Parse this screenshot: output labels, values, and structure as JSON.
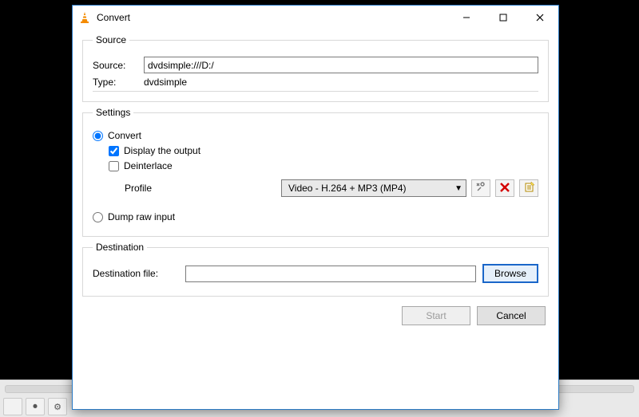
{
  "window": {
    "title": "Convert"
  },
  "source_group": {
    "legend": "Source",
    "source_label": "Source:",
    "source_value": "dvdsimple:///D:/",
    "type_label": "Type:",
    "type_value": "dvdsimple"
  },
  "settings_group": {
    "legend": "Settings",
    "convert_radio": "Convert",
    "display_output": "Display the output",
    "deinterlace": "Deinterlace",
    "profile_label": "Profile",
    "profile_value": "Video - H.264 + MP3 (MP4)",
    "dump_raw": "Dump raw input"
  },
  "destination_group": {
    "legend": "Destination",
    "dest_label": "Destination file:",
    "dest_value": "",
    "browse": "Browse"
  },
  "footer": {
    "start": "Start",
    "cancel": "Cancel"
  },
  "icons": {
    "wrench": "wrench-icon",
    "delete": "delete-icon",
    "new": "new-profile-icon"
  }
}
